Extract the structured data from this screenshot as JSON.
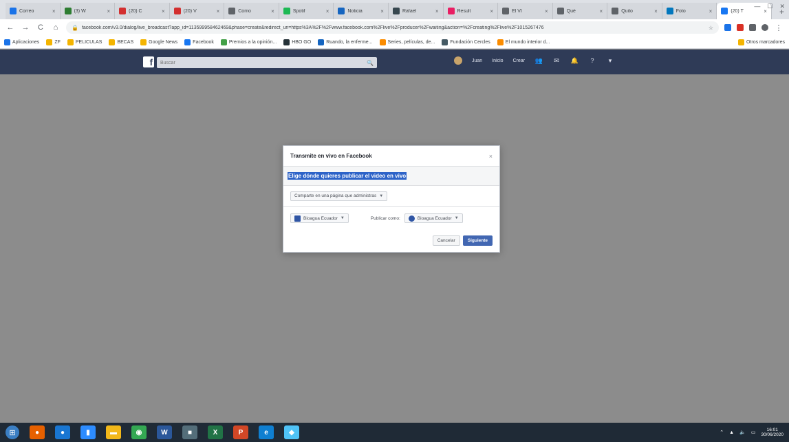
{
  "browser": {
    "tabs": [
      {
        "label": "Correo",
        "color": "#1a73e8"
      },
      {
        "label": "(3) W",
        "color": "#2e7d32"
      },
      {
        "label": "(20) C",
        "color": "#d32f2f"
      },
      {
        "label": "(20) V",
        "color": "#d32f2f"
      },
      {
        "label": "Como",
        "color": "#5f6368"
      },
      {
        "label": "Spotif",
        "color": "#1db954"
      },
      {
        "label": "Noticia",
        "color": "#1565c0"
      },
      {
        "label": "Rafael",
        "color": "#37474f"
      },
      {
        "label": "Result",
        "color": "#e91e63"
      },
      {
        "label": "El VI",
        "color": "#5f6368"
      },
      {
        "label": "Qué",
        "color": "#5f6368"
      },
      {
        "label": "Quito",
        "color": "#5f6368"
      },
      {
        "label": "Foto",
        "color": "#0277bd"
      },
      {
        "label": "(20) T",
        "color": "#1877f2",
        "active": true
      }
    ],
    "new_tab_glyph": "+",
    "window_controls": [
      "—",
      "☐",
      "✕"
    ],
    "url": "facebook.com/v3.0/dialog/live_broadcast?app_id=113599958462469&phase=create&redirect_uri=https%3A%2F%2Fwww.facebook.com%2Flive%2Fproducer%2Fwaiting&action=%2Fcreating%2Flive%2F1015267476",
    "nav": {
      "back": "←",
      "forward": "→",
      "reload": "C",
      "home": "⌂"
    },
    "bookmarks": [
      {
        "label": "Aplicaciones",
        "color": "#1a73e8"
      },
      {
        "label": "ZF",
        "color": "#f4b400"
      },
      {
        "label": "PELICULAS",
        "color": "#f4b400"
      },
      {
        "label": "BECAS",
        "color": "#f4b400"
      },
      {
        "label": "Google News",
        "color": "#f4b400"
      },
      {
        "label": "Facebook",
        "color": "#1877f2"
      },
      {
        "label": "Premios a la opinión...",
        "color": "#43a047"
      },
      {
        "label": "HBO GO",
        "color": "#263238"
      },
      {
        "label": "Ruando, la enferme...",
        "color": "#1565c0"
      },
      {
        "label": "Series, películas, de...",
        "color": "#fb8c00"
      },
      {
        "label": "Fundación Cercles",
        "color": "#455a64"
      },
      {
        "label": "El mundo interior d...",
        "color": "#fb8c00"
      }
    ],
    "bookmarks_other": "Otros marcadores"
  },
  "facebook": {
    "logo": "f",
    "search_placeholder": "Buscar",
    "search_icon": "search-icon",
    "nav": {
      "profile": "Juan",
      "home": "Inicio",
      "create": "Crear"
    }
  },
  "dialog": {
    "title": "Transmite en vivo en Facebook",
    "close": "×",
    "prompt": "Elige dónde quieres publicar el video en vivo",
    "destination": "Comparte en una página que administras",
    "page_name": "Bioagua Ecuador",
    "post_as_label": "Publicar como:",
    "post_as_value": "Bioagua Ecuador",
    "cancel": "Cancelar",
    "next": "Siguiente"
  },
  "taskbar": {
    "apps": [
      {
        "name": "start",
        "color": "#3b7fc4"
      },
      {
        "name": "firefox",
        "color": "#e66000",
        "glyph": "●"
      },
      {
        "name": "browser",
        "color": "#1976d2",
        "glyph": "●"
      },
      {
        "name": "zoom",
        "color": "#2d8cff",
        "glyph": "▮"
      },
      {
        "name": "files",
        "color": "#f2b81a",
        "glyph": "▬"
      },
      {
        "name": "chrome",
        "color": "#34a853",
        "glyph": "◉"
      },
      {
        "name": "word",
        "color": "#2b579a",
        "glyph": "W"
      },
      {
        "name": "app-box",
        "color": "#546e7a",
        "glyph": "■"
      },
      {
        "name": "excel",
        "color": "#217346",
        "glyph": "X"
      },
      {
        "name": "powerpoint",
        "color": "#d24726",
        "glyph": "P"
      },
      {
        "name": "edge",
        "color": "#0f7fd1",
        "glyph": "e"
      },
      {
        "name": "messenger",
        "color": "#4fc3f7",
        "glyph": "◆"
      }
    ],
    "clock_time": "16:01",
    "clock_date": "30/06/2020"
  }
}
